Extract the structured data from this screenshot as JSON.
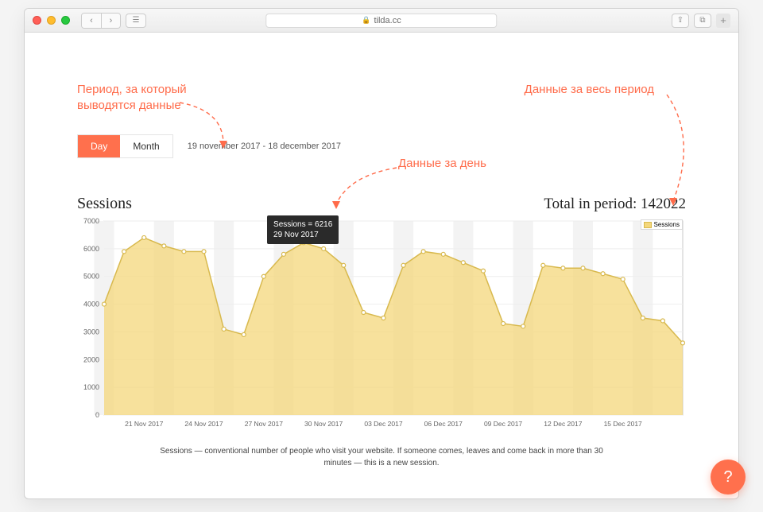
{
  "browser": {
    "url": "tilda.cc"
  },
  "annotations": {
    "period": "Период, за который выводятся данные",
    "whole": "Данные за весь период",
    "day": "Данные за день"
  },
  "toolbar": {
    "day_label": "Day",
    "month_label": "Month",
    "range_text": "19 november 2017 - 18 december 2017"
  },
  "chart": {
    "title": "Sessions",
    "total_label": "Total in period:",
    "total_value": "142022",
    "legend": "Sessions"
  },
  "tooltip": {
    "line1": "Sessions = 6216",
    "line2": "29 Nov 2017"
  },
  "footnote": "Sessions — conventional number of people who visit your website. If someone comes, leaves and come back in more than 30 minutes — this is a new session.",
  "help": "?",
  "chart_data": {
    "type": "area",
    "title": "Sessions",
    "ylabel": "",
    "xlabel": "",
    "ylim": [
      0,
      7000
    ],
    "yticks": [
      0,
      1000,
      2000,
      3000,
      4000,
      5000,
      6000,
      7000
    ],
    "xticks": [
      "21 Nov 2017",
      "24 Nov 2017",
      "27 Nov 2017",
      "30 Nov 2017",
      "03 Dec 2017",
      "06 Dec 2017",
      "09 Dec 2017",
      "12 Dec 2017",
      "15 Dec 2017"
    ],
    "categories": [
      "19 Nov 2017",
      "20 Nov 2017",
      "21 Nov 2017",
      "22 Nov 2017",
      "23 Nov 2017",
      "24 Nov 2017",
      "25 Nov 2017",
      "26 Nov 2017",
      "27 Nov 2017",
      "28 Nov 2017",
      "29 Nov 2017",
      "30 Nov 2017",
      "01 Dec 2017",
      "02 Dec 2017",
      "03 Dec 2017",
      "04 Dec 2017",
      "05 Dec 2017",
      "06 Dec 2017",
      "07 Dec 2017",
      "08 Dec 2017",
      "09 Dec 2017",
      "10 Dec 2017",
      "11 Dec 2017",
      "12 Dec 2017",
      "13 Dec 2017",
      "14 Dec 2017",
      "15 Dec 2017",
      "16 Dec 2017",
      "17 Dec 2017",
      "18 Dec 2017"
    ],
    "series": [
      {
        "name": "Sessions",
        "values": [
          4000,
          5900,
          6400,
          6100,
          5900,
          5900,
          3100,
          2900,
          5000,
          5800,
          6216,
          6000,
          5400,
          3700,
          3500,
          5400,
          5900,
          5800,
          5500,
          5200,
          3300,
          3200,
          5400,
          5300,
          5300,
          5100,
          4900,
          3500,
          3400,
          2600
        ]
      }
    ],
    "highlight": {
      "index": 10,
      "label": "29 Nov 2017",
      "value": 6216
    }
  }
}
